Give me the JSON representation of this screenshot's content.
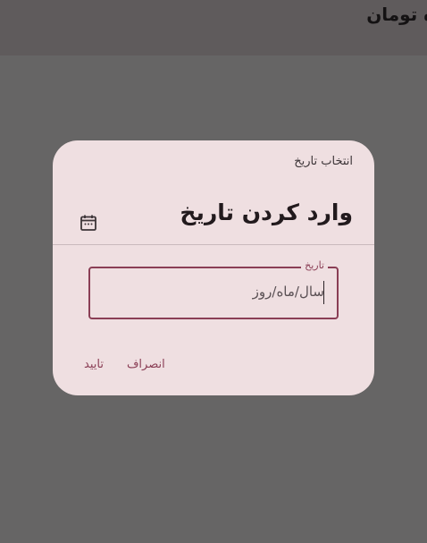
{
  "appbar": {
    "title": "ه تومان"
  },
  "dialog": {
    "label": "انتخاب تاریخ",
    "headline": "وارد کردن تاریخ",
    "calendar_icon": "calendar-icon",
    "field": {
      "label": "تاریخ",
      "placeholder": "سال/ماه/روز",
      "value": ""
    },
    "actions": {
      "cancel_label": "انصراف",
      "confirm_label": "تایید"
    }
  },
  "colors": {
    "scrim": "#666565",
    "appbar": "#5f5b5c",
    "surface": "#efdfe1",
    "primary": "#8a3e55"
  }
}
